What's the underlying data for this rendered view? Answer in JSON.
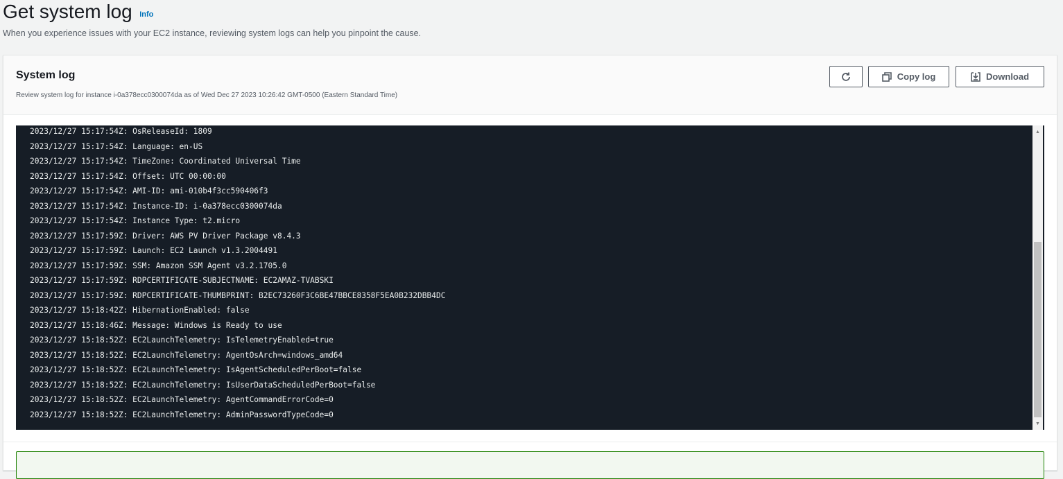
{
  "header": {
    "title": "Get system log",
    "info_label": "Info",
    "description": "When you experience issues with your EC2 instance, reviewing system logs can help you pinpoint the cause."
  },
  "panel": {
    "title": "System log",
    "subtitle": "Review system log for instance i-0a378ecc0300074da as of Wed Dec 27 2023 10:26:42 GMT-0500 (Eastern Standard Time)",
    "refresh_icon": "refresh-icon",
    "copy_label": "Copy log",
    "copy_icon": "copy-icon",
    "download_label": "Download",
    "download_icon": "download-icon"
  },
  "log": {
    "lines": [
      "2023/12/27 15:17:54Z: OsReleaseId: 1809",
      "2023/12/27 15:17:54Z: Language: en-US",
      "2023/12/27 15:17:54Z: TimeZone: Coordinated Universal Time",
      "2023/12/27 15:17:54Z: Offset: UTC 00:00:00",
      "2023/12/27 15:17:54Z: AMI-ID: ami-010b4f3cc590406f3",
      "2023/12/27 15:17:54Z: Instance-ID: i-0a378ecc0300074da",
      "2023/12/27 15:17:54Z: Instance Type: t2.micro",
      "2023/12/27 15:17:59Z: Driver: AWS PV Driver Package v8.4.3",
      "2023/12/27 15:17:59Z: Launch: EC2 Launch v1.3.2004491",
      "2023/12/27 15:17:59Z: SSM: Amazon SSM Agent v3.2.1705.0",
      "2023/12/27 15:17:59Z: RDPCERTIFICATE-SUBJECTNAME: EC2AMAZ-TVABSKI",
      "2023/12/27 15:17:59Z: RDPCERTIFICATE-THUMBPRINT: B2EC73260F3C6BE47BBCE8358F5EA0B232DBB4DC",
      "2023/12/27 15:18:42Z: HibernationEnabled: false",
      "2023/12/27 15:18:46Z: Message: Windows is Ready to use",
      "2023/12/27 15:18:52Z: EC2LaunchTelemetry: IsTelemetryEnabled=true",
      "2023/12/27 15:18:52Z: EC2LaunchTelemetry: AgentOsArch=windows_amd64",
      "2023/12/27 15:18:52Z: EC2LaunchTelemetry: IsAgentScheduledPerBoot=false",
      "2023/12/27 15:18:52Z: EC2LaunchTelemetry: IsUserDataScheduledPerBoot=false",
      "2023/12/27 15:18:52Z: EC2LaunchTelemetry: AgentCommandErrorCode=0",
      "2023/12/27 15:18:52Z: EC2LaunchTelemetry: AdminPasswordTypeCode=0"
    ],
    "scroll_position": 0.9
  },
  "colors": {
    "link": "#0073bb",
    "log_background": "#161d26",
    "success_border": "#1d8102"
  }
}
